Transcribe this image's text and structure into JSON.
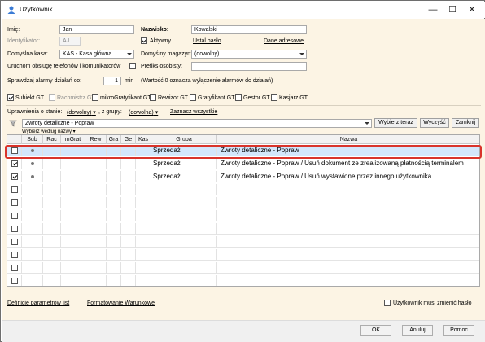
{
  "window": {
    "title": "Użytkownik",
    "minimize": "—",
    "maximize": "☐",
    "close": "✕"
  },
  "form": {
    "imie_label": "Imię:",
    "imie_value": "Jan",
    "nazwisko_label": "Nazwisko:",
    "nazwisko_value": "Kowalski",
    "identyfikator_label": "Identyfikator:",
    "identyfikator_value": "AJ",
    "aktywny_label": "Aktywny",
    "aktywny_checked": true,
    "ustal_haslo": "Ustal hasło",
    "dane_adresowe": "Dane adresowe",
    "kasa_label": "Domyślna kasa:",
    "kasa_value": "KAS - Kasa główna",
    "magazyn_label": "Domyślny magazyn:",
    "magazyn_value": "(dowolny)",
    "uruchom_label": "Uruchom obsługę telefonów i komunikatorów",
    "prefiks_label": "Prefiks osobisty:",
    "prefiks_value": "",
    "alarm_label": "Sprawdzaj alarmy działań co:",
    "alarm_value": "1",
    "alarm_unit": "min",
    "alarm_note": "(Wartość 0 oznacza wyłączenie alarmów do działań)"
  },
  "roles": [
    {
      "label": "Subiekt GT",
      "checked": true,
      "disabled": false
    },
    {
      "label": "Rachmistrz GT",
      "checked": false,
      "disabled": true
    },
    {
      "label": "mikroGratyfikant GT",
      "checked": false,
      "disabled": false
    },
    {
      "label": "Rewizor GT",
      "checked": false,
      "disabled": false
    },
    {
      "label": "Gratyfikant GT",
      "checked": false,
      "disabled": false
    },
    {
      "label": "Gestor GT",
      "checked": false,
      "disabled": false
    },
    {
      "label": "Kasjarz GT",
      "checked": false,
      "disabled": false
    }
  ],
  "permissions": {
    "stan_label": "Uprawnienia o stanie:",
    "stan_value": "(dowolny)",
    "grupa_label": ", z grupy:",
    "grupa_value": "(dowolna)",
    "zaznacz": "Zaznacz wszystkie",
    "search_value": "Zwroty detaliczne - Popraw",
    "wybierz_teraz": "Wybierz teraz",
    "wyczysc": "Wyczyść",
    "zamknij": "Zamknij",
    "wybierz_wedlug": "Wybierz według nazwy"
  },
  "grid": {
    "columns": [
      "Sub",
      "Rac",
      "mGrat",
      "Rew",
      "Gra",
      "Ge",
      "Kas",
      "Grupa",
      "Nazwa"
    ],
    "rows": [
      {
        "checked": false,
        "sub": true,
        "grupa": "Sprzedaż",
        "nazwa": "Zwroty detaliczne - Popraw",
        "selected": true
      },
      {
        "checked": true,
        "sub": true,
        "grupa": "Sprzedaż",
        "nazwa": "Zwroty detaliczne - Popraw / Usuń dokument ze zrealizowaną płatnością terminalem",
        "selected": false
      },
      {
        "checked": true,
        "sub": true,
        "grupa": "Sprzedaż",
        "nazwa": "Zwroty detaliczne - Popraw / Usuń wystawione przez innego użytkownika",
        "selected": false
      }
    ],
    "empty_rows": 8
  },
  "bottom": {
    "definicje": "Definicje parametrów list",
    "formatowanie": "Formatowanie Warunkowe",
    "zmien_haslo": "Użytkownik musi zmienić hasło"
  },
  "buttons": {
    "ok": "OK",
    "anuluj": "Anuluj",
    "pomoc": "Pomoc"
  },
  "colors": {
    "background": "#fcf4e4",
    "selection": "#d3e7fb",
    "highlight": "#d9342b"
  }
}
